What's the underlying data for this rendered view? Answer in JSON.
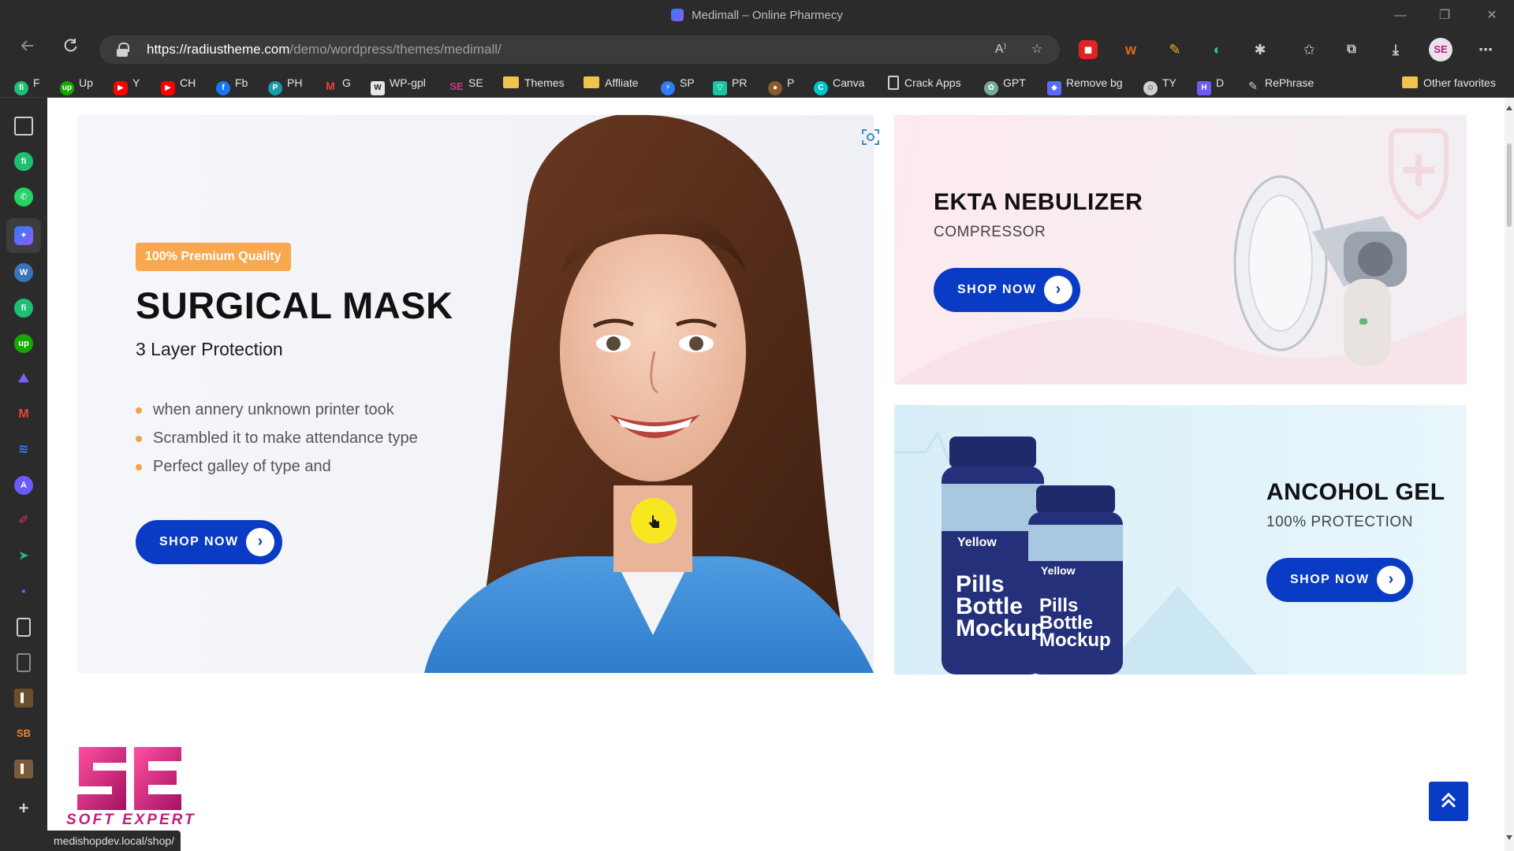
{
  "window": {
    "title": "Medimall – Online Pharmecy",
    "controls": {
      "minimize": "—",
      "restore": "❐",
      "close": "✕"
    }
  },
  "toolbar": {
    "url_domain": "https://radiustheme.com",
    "url_path": "/demo/wordpress/themes/medimall/"
  },
  "bookmarks": [
    {
      "label": "F",
      "icon": "fiverr-icon",
      "color": "#1dbf73"
    },
    {
      "label": "Up",
      "icon": "upwork-icon",
      "color": "#14a800"
    },
    {
      "label": "Y",
      "icon": "youtube-icon",
      "color": "#ff0000"
    },
    {
      "label": "CH",
      "icon": "youtube-icon",
      "color": "#ff0000"
    },
    {
      "label": "Fb",
      "icon": "facebook-icon",
      "color": "#1877f2"
    },
    {
      "label": "PH",
      "icon": "ph-icon",
      "color": "#1b9aaa"
    },
    {
      "label": "G",
      "icon": "gmail-icon",
      "color": "#ea4335"
    },
    {
      "label": "WP-gpl",
      "icon": "wp-icon",
      "color": "#e6e6e6"
    },
    {
      "label": "SE",
      "icon": "se-icon",
      "color": "#d63384"
    },
    {
      "label": "Themes",
      "icon": "folder-icon",
      "color": "#f2c14e"
    },
    {
      "label": "Affliate",
      "icon": "folder-icon",
      "color": "#f2c14e"
    },
    {
      "label": "SP",
      "icon": "sp-icon",
      "color": "#2f7cf6"
    },
    {
      "label": "PR",
      "icon": "pr-icon",
      "color": "#19c3a6"
    },
    {
      "label": "P",
      "icon": "person-icon",
      "color": "#8b5a2b"
    },
    {
      "label": "Canva",
      "icon": "canva-icon",
      "color": "#00c4cc"
    },
    {
      "label": "Crack Apps",
      "icon": "document-icon",
      "color": "#cfcfcf"
    },
    {
      "label": "GPT",
      "icon": "chatgpt-icon",
      "color": "#74aa9c"
    },
    {
      "label": "Remove bg",
      "icon": "removebg-icon",
      "color": "#5a6cf7"
    },
    {
      "label": "TY",
      "icon": "ty-icon",
      "color": "#cfcfcf"
    },
    {
      "label": "D",
      "icon": "d-icon",
      "color": "#6b5bf7"
    },
    {
      "label": "RePhrase",
      "icon": "pen-icon",
      "color": "#cfcfcf"
    },
    {
      "label": "Other favorites",
      "icon": "folder-icon",
      "color": "#f2c14e"
    }
  ],
  "hero": {
    "badge": "100% Premium Quality",
    "title": "SURGICAL MASK",
    "subtitle": "3 Layer Protection",
    "bullets": [
      "when annery unknown printer took",
      "Scrambled it to make attendance type",
      "Perfect galley of type and"
    ],
    "cta": "SHOP NOW"
  },
  "cards": [
    {
      "title": "EKTA NEBULIZER",
      "subtitle": "COMPRESSOR",
      "cta": "SHOP NOW"
    },
    {
      "title": "ANCOHOL GEL",
      "subtitle": "100% PROTECTION",
      "cta": "SHOP NOW"
    }
  ],
  "bottles": [
    {
      "brand": "Yellow",
      "line1": "Pills",
      "line2": "Bottle",
      "line3": "Mockup"
    },
    {
      "brand": "Yellow",
      "line1": "Pills",
      "line2": "Bottle",
      "line3": "Mockup"
    }
  ],
  "watermark": {
    "monogram": "SE",
    "text": "SOFT EXPERT"
  },
  "status_bar": {
    "url": "medishopdev.local/shop/"
  },
  "colors": {
    "primary": "#0a3bc4",
    "badge": "#f8a84f",
    "brand_pink": "#c21d7f"
  }
}
